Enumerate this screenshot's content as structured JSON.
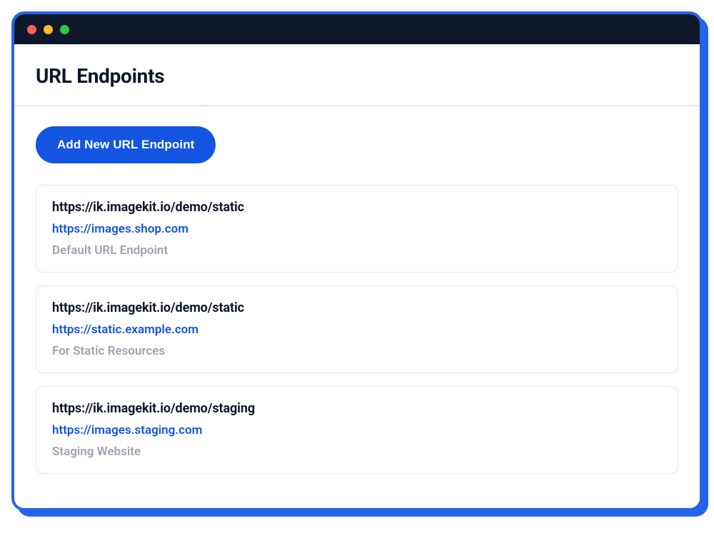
{
  "header": {
    "title": "URL Endpoints"
  },
  "actions": {
    "add_label": "Add New URL Endpoint"
  },
  "endpoints": [
    {
      "primary_url": "https://ik.imagekit.io/demo/static",
      "alias_url": "https://images.shop.com",
      "description": "Default URL Endpoint"
    },
    {
      "primary_url": "https://ik.imagekit.io/demo/static",
      "alias_url": "https://static.example.com",
      "description": "For Static Resources"
    },
    {
      "primary_url": "https://ik.imagekit.io/demo/staging",
      "alias_url": "https://images.staging.com",
      "description": "Staging Website"
    }
  ]
}
